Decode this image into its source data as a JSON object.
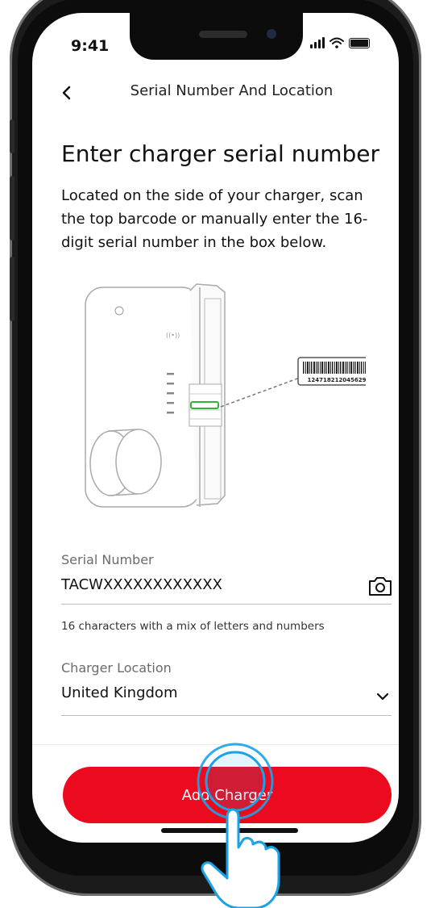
{
  "status_bar": {
    "time": "9:41"
  },
  "header": {
    "title": "Serial Number And Location"
  },
  "main": {
    "heading": "Enter charger serial number",
    "description": "Located on the side of your charger, scan the top barcode or manually enter the 16-digit serial number in the box below."
  },
  "illustration": {
    "barcode_number": "124718212045629"
  },
  "form": {
    "serial": {
      "label": "Serial Number",
      "value": "TACWXXXXXXXXXXXX",
      "hint": "16 characters with a mix of letters and numbers"
    },
    "location": {
      "label": "Charger Location",
      "value": "United Kingdom"
    }
  },
  "actions": {
    "add_charger_label": "Add Charger"
  },
  "colors": {
    "accent": "#eb0a1e",
    "tap_ring": "#1aa3e8"
  },
  "icons": [
    "back-arrow-icon",
    "camera-icon",
    "chevron-down-icon",
    "signal-icon",
    "wifi-icon",
    "battery-icon",
    "tap-hand-icon"
  ]
}
